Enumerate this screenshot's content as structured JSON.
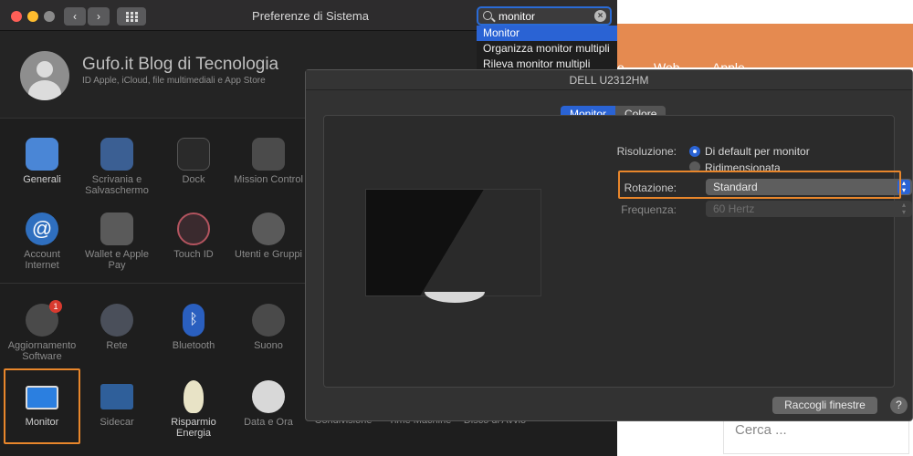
{
  "background_page": {
    "menu": [
      "o",
      "Web",
      "Apple"
    ],
    "search_placeholder": "Cerca ..."
  },
  "window": {
    "title": "Preferenze di Sistema",
    "back_label": "‹",
    "forward_label": "›"
  },
  "search": {
    "value": "monitor",
    "clear_label": "×",
    "suggestions": [
      "Monitor",
      "Organizza monitor multipli",
      "Rileva monitor multipli"
    ]
  },
  "profile": {
    "name": "Gufo.it  Blog di Tecnologia",
    "subtitle": "ID Apple, iCloud, file multimediali e App Store"
  },
  "prefs": {
    "generali": "Generali",
    "scrivania": "Scrivania e Salvaschermo",
    "dock": "Dock",
    "mission": "Mission Control",
    "account": "Account Internet",
    "wallet": "Wallet e Apple Pay",
    "touchid": "Touch ID",
    "utenti": "Utenti e Gruppi",
    "aggiornamento": "Aggiornamento Software",
    "aggiornamento_badge": "1",
    "rete": "Rete",
    "bluetooth": "Bluetooth",
    "suono": "Suono",
    "monitor": "Monitor",
    "sidecar": "Sidecar",
    "risparmio": "Risparmio Energia",
    "dataora": "Data e Ora",
    "condivisione": "Condivisione",
    "timemachine": "Time Machine",
    "disco": "Disco di Avvio"
  },
  "display": {
    "title": "DELL U2312HM",
    "tabs": [
      "Monitor",
      "Colore"
    ],
    "resolution_label": "Risoluzione:",
    "resolution_options": [
      "Di default per monitor",
      "Ridimensionata"
    ],
    "rotation_label": "Rotazione:",
    "rotation_value": "Standard",
    "frequency_label": "Frequenza:",
    "frequency_value": "60 Hertz",
    "gather_button": "Raccogli finestre",
    "help_button": "?"
  },
  "colors": {
    "accent_blue": "#2a63d4",
    "highlight_orange": "#e8862b"
  }
}
